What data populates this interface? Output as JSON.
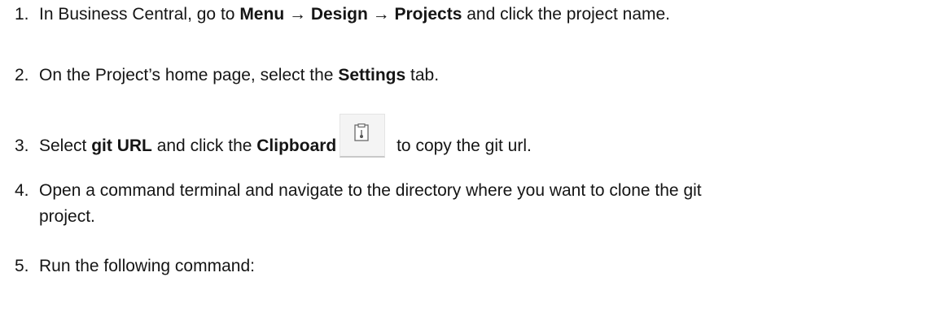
{
  "steps": [
    {
      "number": "1.",
      "text_1": "In Business Central, go to ",
      "bold_1": "Menu",
      "arrow_1": " → ",
      "bold_2": "Design",
      "arrow_2": " → ",
      "bold_3": "Projects",
      "text_2": " and click the project name."
    },
    {
      "number": "2.",
      "text_1": "On the Project’s home page, select the ",
      "bold_1": "Settings",
      "text_2": " tab."
    },
    {
      "number": "3.",
      "text_1": "Select ",
      "bold_1": "git URL",
      "text_2": " and click the ",
      "bold_2": "Clipboard",
      "text_3": " to copy the git url.",
      "icon": "clipboard-icon"
    },
    {
      "number": "4.",
      "line_1": "Open a command terminal and navigate to the directory where you want to clone the git",
      "line_2": "project."
    },
    {
      "number": "5.",
      "text_1": "Run the following command:"
    }
  ]
}
